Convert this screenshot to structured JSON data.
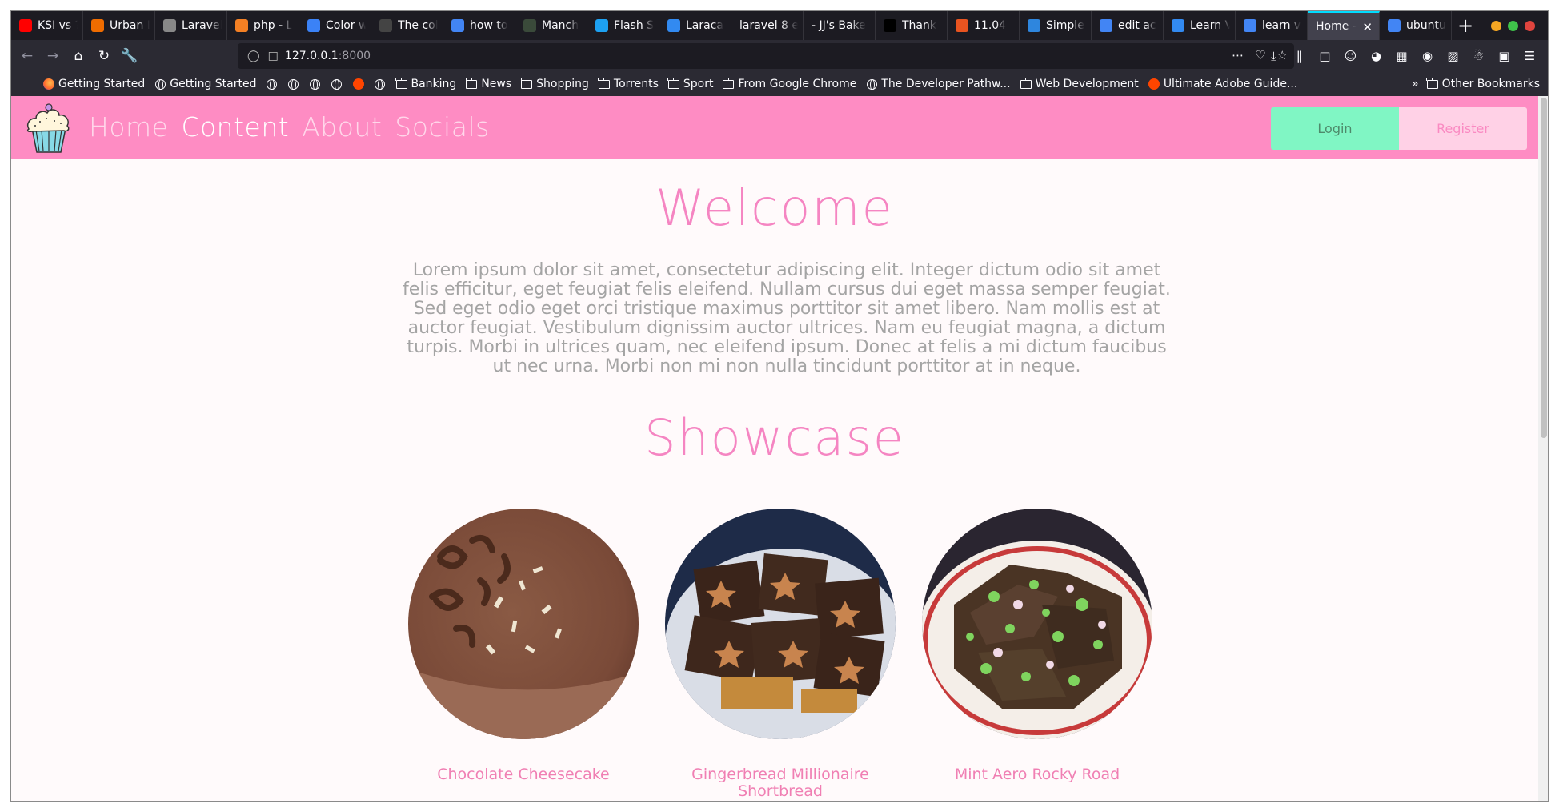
{
  "browser": {
    "tabs": [
      {
        "title": "KSI vs ?",
        "icon_color": "#ff0000",
        "icon": "youtube-icon"
      },
      {
        "title": "Urban D",
        "icon_color": "#ef6c00",
        "icon": "urban-dictionary-icon"
      },
      {
        "title": "Laravel",
        "icon_color": "#888888",
        "icon": "laravel-icon"
      },
      {
        "title": "php - L",
        "icon_color": "#f48024",
        "icon": "stackoverflow-icon"
      },
      {
        "title": "Color w",
        "icon_color": "#3b82f6",
        "icon": "color-icon"
      },
      {
        "title": "The col",
        "icon_color": "#444444",
        "icon": "page-icon"
      },
      {
        "title": "how to",
        "icon_color": "#4285f4",
        "icon": "google-icon"
      },
      {
        "title": "Manch",
        "icon_color": "#3a4a3a",
        "icon": "football-icon"
      },
      {
        "title": "Flash S",
        "icon_color": "#1da1f2",
        "icon": "twitter-icon"
      },
      {
        "title": "Laraca",
        "icon_color": "#328af1",
        "icon": "laracasts-icon"
      },
      {
        "title": "laravel 8 e",
        "icon_color": "",
        "icon": ""
      },
      {
        "title": "- JJ's Bake",
        "icon_color": "",
        "icon": ""
      },
      {
        "title": "Thank",
        "icon_color": "#000000",
        "icon": "jetbrains-icon"
      },
      {
        "title": "11.04",
        "icon_color": "#e95420",
        "icon": "askubuntu-icon"
      },
      {
        "title": "Simple",
        "icon_color": "#2e86de",
        "icon": "loading-icon"
      },
      {
        "title": "edit ac",
        "icon_color": "#4285f4",
        "icon": "google-icon"
      },
      {
        "title": "Learn V",
        "icon_color": "#328af1",
        "icon": "laracasts-icon"
      },
      {
        "title": "learn v",
        "icon_color": "#4285f4",
        "icon": "google-icon"
      },
      {
        "title": "Home -",
        "icon_color": "",
        "icon": "",
        "active": true
      },
      {
        "title": "ubuntu",
        "icon_color": "#4285f4",
        "icon": "google-icon"
      }
    ],
    "url": {
      "host": "127.0.0.1",
      "port": ":8000"
    },
    "bookmarks": [
      {
        "label": "Getting Started",
        "icon": "firefox-icon"
      },
      {
        "label": "Getting Started",
        "icon": "globe-icon"
      },
      {
        "label": "",
        "icon": "globe-icon"
      },
      {
        "label": "",
        "icon": "globe-icon"
      },
      {
        "label": "",
        "icon": "globe-icon"
      },
      {
        "label": "",
        "icon": "globe-icon"
      },
      {
        "label": "",
        "icon": "reddit-icon"
      },
      {
        "label": "",
        "icon": "globe-icon"
      },
      {
        "label": "Banking",
        "icon": "folder-icon"
      },
      {
        "label": "News",
        "icon": "folder-icon"
      },
      {
        "label": "Shopping",
        "icon": "folder-icon"
      },
      {
        "label": "Torrents",
        "icon": "folder-icon"
      },
      {
        "label": "Sport",
        "icon": "folder-icon"
      },
      {
        "label": "From Google Chrome",
        "icon": "folder-icon"
      },
      {
        "label": "The Developer Pathw...",
        "icon": "globe-icon"
      },
      {
        "label": "Web Development",
        "icon": "folder-icon"
      },
      {
        "label": "Ultimate Adobe Guide...",
        "icon": "reddit-icon"
      }
    ],
    "other_bookmarks": "Other Bookmarks"
  },
  "site": {
    "nav": {
      "links": [
        {
          "label": "Home",
          "active": false
        },
        {
          "label": "Content",
          "active": true
        },
        {
          "label": "About",
          "active": false
        },
        {
          "label": "Socials",
          "active": false
        }
      ],
      "login": "Login",
      "register": "Register"
    },
    "welcome_title": "Welcome",
    "welcome_text": "Lorem ipsum dolor sit amet, consectetur adipiscing elit. Integer dictum odio sit amet felis efficitur, eget feugiat felis eleifend. Nullam cursus dui eget massa semper feugiat. Sed eget odio eget orci tristique maximus porttitor sit amet libero. Nam mollis est at auctor feugiat. Vestibulum dignissim auctor ultrices. Nam eu feugiat magna, a dictum turpis. Morbi in ultrices quam, nec eleifend ipsum. Donec at felis a mi dictum faucibus ut nec urna. Morbi non mi non nulla tincidunt porttitor at in neque.",
    "showcase_title": "Showcase",
    "showcase": [
      {
        "caption": "Chocolate Cheesecake"
      },
      {
        "caption": "Gingerbread Millionaire Shortbread"
      },
      {
        "caption": "Mint Aero Rocky Road"
      }
    ]
  },
  "colors": {
    "nav_pink": "#fe8cc3",
    "heading_pink": "#f585c2",
    "login_green": "#80f6c4",
    "register_pink": "#ffd1e6"
  }
}
